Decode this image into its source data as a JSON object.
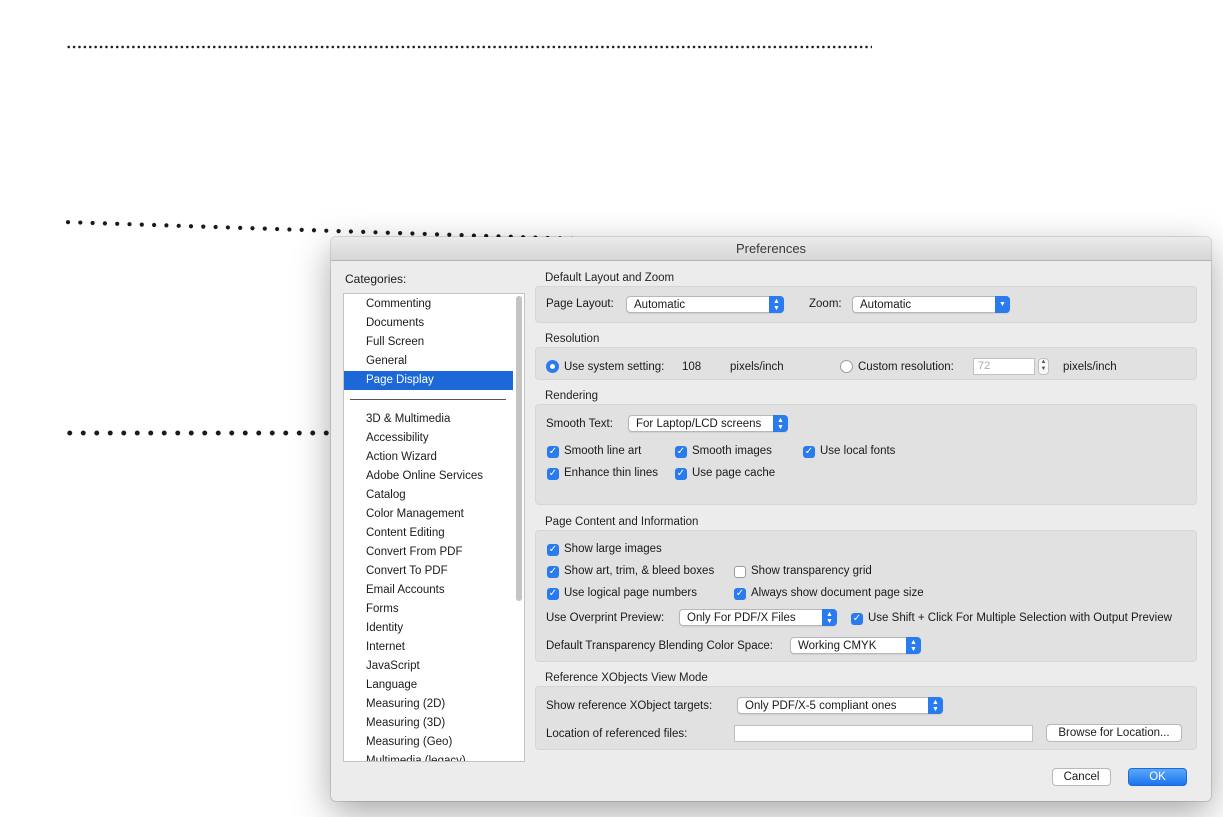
{
  "window": {
    "title": "Preferences"
  },
  "categories": {
    "label": "Categories:",
    "top_items": [
      "Commenting",
      "Documents",
      "Full Screen",
      "General",
      "Page Display"
    ],
    "selected": "Page Display",
    "more_items": [
      "3D & Multimedia",
      "Accessibility",
      "Action Wizard",
      "Adobe Online Services",
      "Catalog",
      "Color Management",
      "Content Editing",
      "Convert From PDF",
      "Convert To PDF",
      "Email Accounts",
      "Forms",
      "Identity",
      "Internet",
      "JavaScript",
      "Language",
      "Measuring (2D)",
      "Measuring (3D)",
      "Measuring (Geo)",
      "Multimedia (legacy)"
    ]
  },
  "layout_zoom": {
    "title": "Default Layout and Zoom",
    "page_layout_label": "Page Layout:",
    "page_layout_value": "Automatic",
    "zoom_label": "Zoom:",
    "zoom_value": "Automatic"
  },
  "resolution": {
    "title": "Resolution",
    "system_label": "Use system setting:",
    "system_value": "108",
    "system_unit": "pixels/inch",
    "custom_label": "Custom resolution:",
    "custom_value": "72",
    "custom_unit": "pixels/inch"
  },
  "rendering": {
    "title": "Rendering",
    "smooth_text_label": "Smooth Text:",
    "smooth_text_value": "For Laptop/LCD screens",
    "smooth_line_art": "Smooth line art",
    "smooth_images": "Smooth images",
    "use_local_fonts": "Use local fonts",
    "enhance_thin_lines": "Enhance thin lines",
    "use_page_cache": "Use page cache"
  },
  "page_content": {
    "title": "Page Content and Information",
    "show_large_images": "Show large images",
    "show_art_trim_bleed": "Show art, trim, & bleed boxes",
    "show_transparency_grid": "Show transparency grid",
    "use_logical_page_numbers": "Use logical page numbers",
    "always_show_page_size": "Always show document page size",
    "overprint_label": "Use Overprint Preview:",
    "overprint_value": "Only For PDF/X Files",
    "shift_click_label": "Use Shift + Click For Multiple Selection with Output Preview",
    "blending_label": "Default Transparency Blending Color Space:",
    "blending_value": "Working CMYK"
  },
  "xobjects": {
    "title": "Reference XObjects View Mode",
    "targets_label": "Show reference XObject targets:",
    "targets_value": "Only PDF/X-5 compliant ones",
    "location_label": "Location of referenced files:",
    "location_value": "",
    "browse_button": "Browse for Location..."
  },
  "buttons": {
    "cancel": "Cancel",
    "ok": "OK"
  },
  "colors": {
    "accent": "#2a7bf0",
    "selection": "#1c68d8"
  }
}
